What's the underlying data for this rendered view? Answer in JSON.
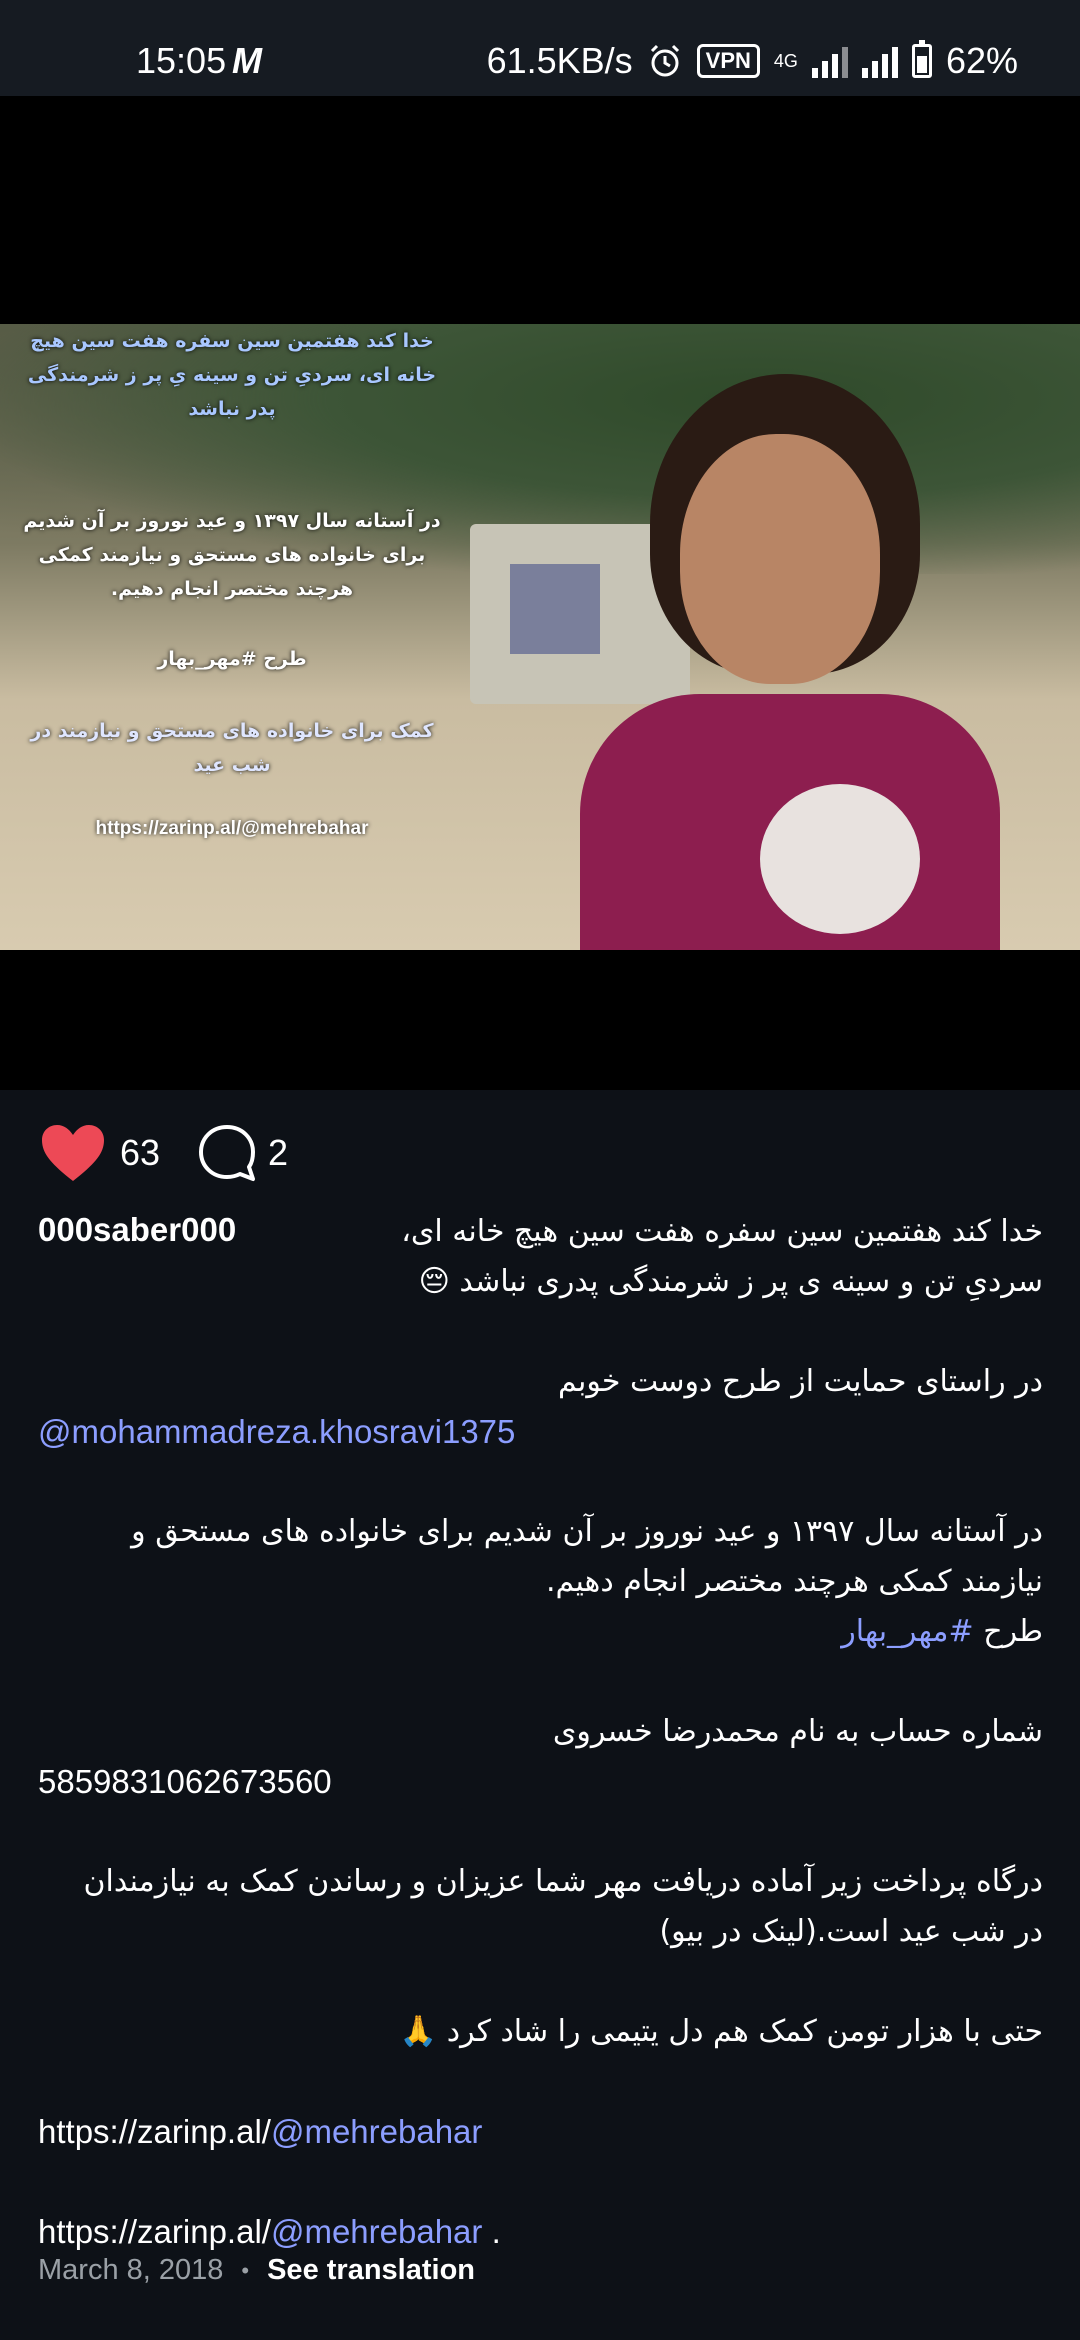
{
  "status_bar": {
    "time": "15:05",
    "carrier_glyph": "M",
    "net_speed": "61.5KB/s",
    "vpn": "VPN",
    "network": "4G",
    "battery": "62%"
  },
  "photo_overlay": {
    "line1": "خدا کند هفتمین سین سفره هفت سین هیچ خانه ای، سردیِ تن و سینه یِ پر ز شرمندگی پدر نباشد",
    "line2": "در آستانه سال ۱۳۹۷ و عید نوروز بر آن شدیم برای خانواده های مستحق و نیازمند کمکی هرچند مختصر انجام دهیم.",
    "line3": "طرح #مهر_بهار",
    "line4": "کمک برای خانواده های مستحق و نیازمند در شب عید",
    "url": "https://zarinp.al/@mehrebahar"
  },
  "actions": {
    "likes": "63",
    "comments": "2",
    "heart_icon": "heart-icon",
    "comment_icon": "comment-icon",
    "like_color": "#ed4956"
  },
  "caption": {
    "username": "000saber000",
    "line1": "خدا کند هفتمین سین سفره هفت سین هیچ خانه ای،",
    "line2": "سردیِ تن و سینه ی پر ز شرمندگی پدری نباشد 😔",
    "support_line": "در راستای حمایت از طرح دوست خوبم",
    "mention": "@mohammadreza.khosravi1375",
    "para_line1": "در آستانه سال ۱۳۹۷ و عید نوروز بر آن شدیم برای خانواده های مستحق و",
    "para_line2": "نیازمند کمکی هرچند مختصر انجام دهیم.",
    "plan_label": "طرح",
    "hashtag": "#مهر_بهار",
    "account_line": "شماره حساب به نام محمدرضا خسروی",
    "account_number": "5859831062673560",
    "gateway_line1": "درگاه پرداخت زیر آماده دریافت مهر شما عزیزان و رساندن کمک به نیازمندان",
    "gateway_line2": "در شب عید است.(لینک در بیو)",
    "even_line": "حتی با هزار تومن کمک هم  دل یتیمی را شاد کرد 🙏",
    "url1_prefix": "https://zarinp.al/",
    "url1_handle": "@mehrebahar",
    "url2_prefix": "https://zarinp.al/",
    "url2_handle": "@mehrebahar",
    "url2_suffix": " ."
  },
  "meta": {
    "date": "March 8, 2018",
    "separator": "•",
    "translate": "See translation"
  }
}
